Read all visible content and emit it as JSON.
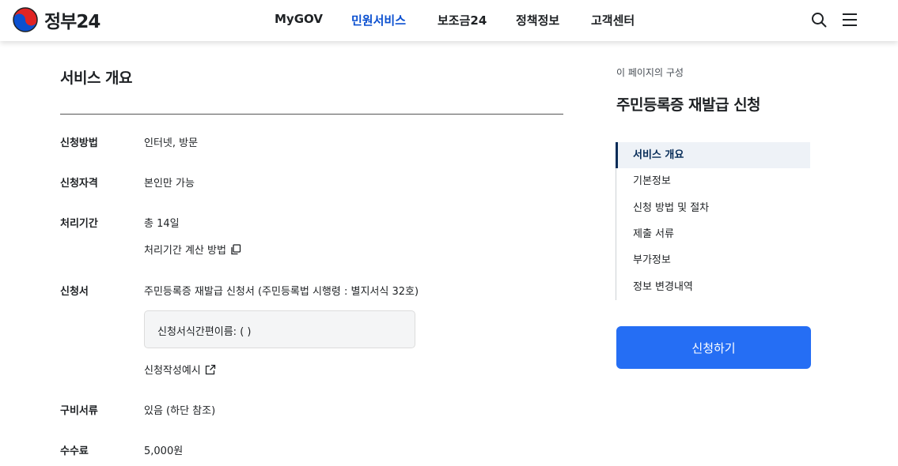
{
  "header": {
    "logo_text": "정부24",
    "nav": [
      {
        "label": "MyGOV",
        "active": false
      },
      {
        "label": "민원서비스",
        "active": true
      },
      {
        "label": "보조금24",
        "active": false
      },
      {
        "label": "정책정보",
        "active": false
      },
      {
        "label": "고객센터",
        "active": false
      }
    ],
    "icons": {
      "search": "search-icon",
      "menu": "hamburger-menu-icon"
    }
  },
  "main": {
    "section_title": "서비스 개요",
    "rows": {
      "method": {
        "label": "신청방법",
        "value": "인터넷, 방문"
      },
      "eligibility": {
        "label": "신청자격",
        "value": "본인만 가능"
      },
      "period": {
        "label": "처리기간",
        "value": "총 14일",
        "link": "처리기간 계산 방법"
      },
      "form": {
        "label": "신청서",
        "value": "주민등록증 재발급 신청서 (주민등록법 시행령 : 별지서식 32호)",
        "box_text": "신청서식간편이름: ( )",
        "link": "신청작성예시"
      },
      "documents": {
        "label": "구비서류",
        "value": "있음 (하단 참조)"
      },
      "fee": {
        "label": "수수료",
        "value": "5,000원"
      }
    }
  },
  "sidebar": {
    "caption": "이 페이지의 구성",
    "title": "주민등록증 재발급 신청",
    "items": [
      {
        "label": "서비스 개요",
        "active": true
      },
      {
        "label": "기본정보",
        "active": false
      },
      {
        "label": "신청 방법 및 절차",
        "active": false
      },
      {
        "label": "제출 서류",
        "active": false
      },
      {
        "label": "부가정보",
        "active": false
      },
      {
        "label": "정보 변경내역",
        "active": false
      }
    ],
    "apply_label": "신청하기"
  },
  "colors": {
    "accent": "#256ef4",
    "nav_active": "#0b50d0",
    "toc_active": "#052b57"
  }
}
